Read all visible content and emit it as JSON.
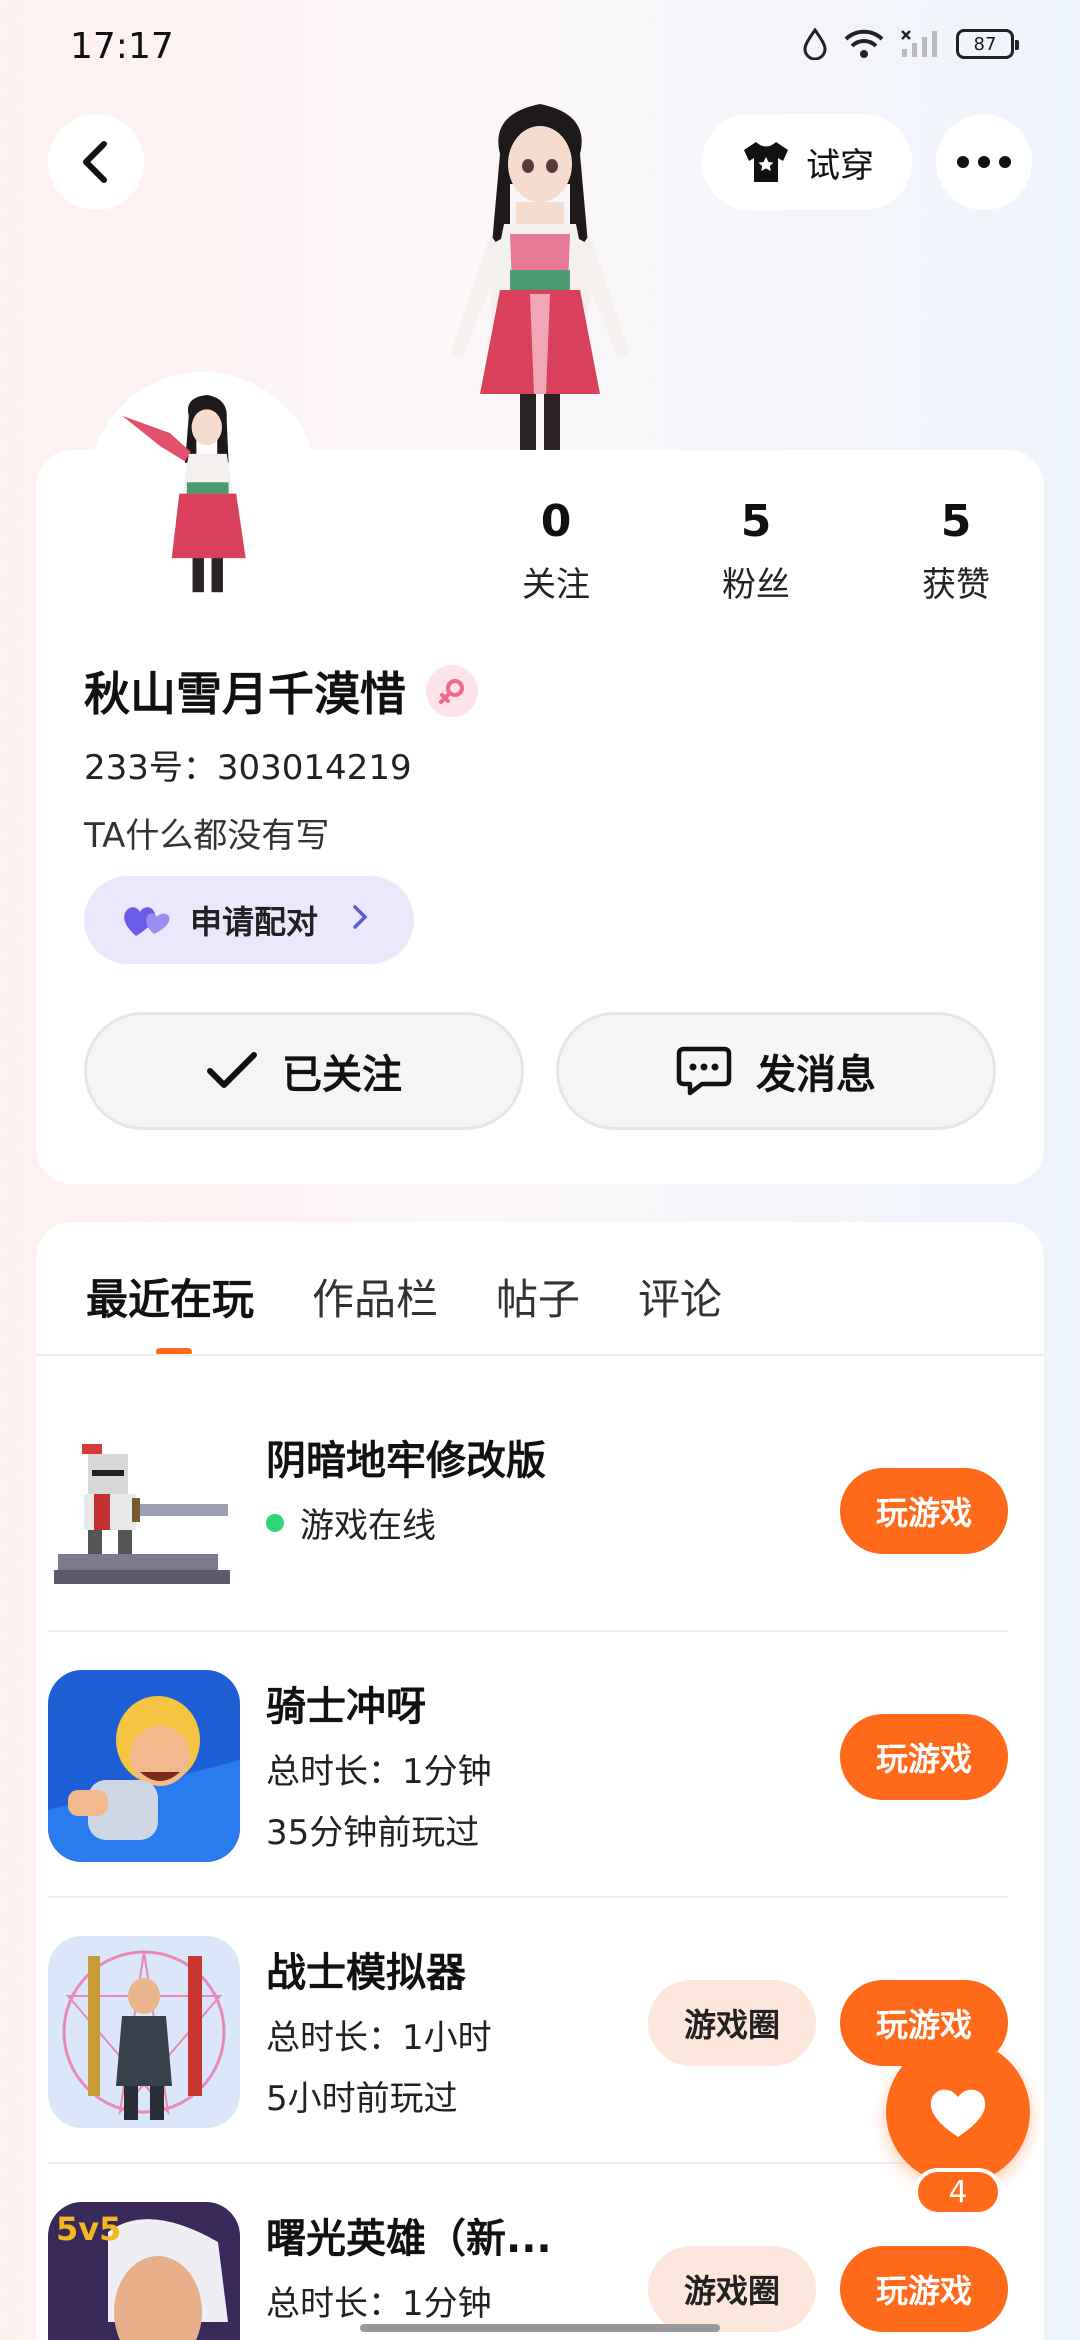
{
  "status_bar": {
    "time": "17:17",
    "battery": "87"
  },
  "header": {
    "try_on_label": "试穿"
  },
  "profile": {
    "stats": [
      {
        "value": "0",
        "label": "关注"
      },
      {
        "value": "5",
        "label": "粉丝"
      },
      {
        "value": "5",
        "label": "获赞"
      }
    ],
    "nickname": "秋山雪月千漠惜",
    "uid": "233号：303014219",
    "bio": "TA什么都没有写",
    "pair_label": "申请配对",
    "follow_label": "已关注",
    "message_label": "发消息"
  },
  "tabs": [
    {
      "label": "最近在玩"
    },
    {
      "label": "作品栏"
    },
    {
      "label": "帖子"
    },
    {
      "label": "评论"
    }
  ],
  "games": [
    {
      "title": "阴暗地牢修改版",
      "line1": "游戏在线",
      "line2": "",
      "play": "玩游戏",
      "circle": ""
    },
    {
      "title": "骑士冲呀",
      "line1": "总时长：1分钟",
      "line2": "35分钟前玩过",
      "play": "玩游戏",
      "circle": ""
    },
    {
      "title": "战士模拟器",
      "line1": "总时长：1小时",
      "line2": "5小时前玩过",
      "play": "玩游戏",
      "circle": "游戏圈"
    },
    {
      "title": "曙光英雄（新...",
      "line1": "总时长：1分钟",
      "line2": "",
      "play": "玩游戏",
      "circle": "游戏圈"
    }
  ],
  "floating": {
    "like_count": "4"
  },
  "colors": {
    "accent": "#ff6a1a",
    "pair_bg": "#ebe8fb",
    "online": "#2fd67a"
  }
}
